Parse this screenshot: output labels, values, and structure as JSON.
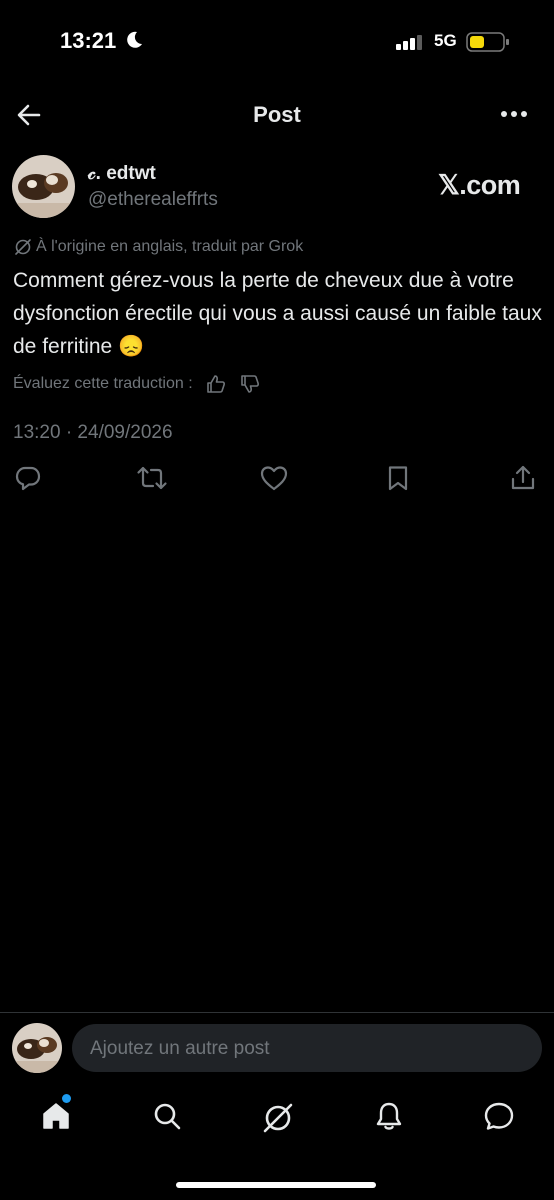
{
  "status_bar": {
    "time": "13:21",
    "network": "5G"
  },
  "header": {
    "title": "Post"
  },
  "post": {
    "author_name": "𝒸. edtwt",
    "author_handle": "@etherealeffrts",
    "source": "𝕏.com",
    "translation_note": "À l'origine en anglais, traduit par Grok",
    "text": "Comment gérez-vous la perte de cheveux due à votre dysfonction érectile qui vous a aussi causé un faible taux de ferritine 😞",
    "rate_label": "Évaluez cette traduction :",
    "timestamp": "13:20 · 24/09/2026"
  },
  "composer": {
    "placeholder": "Ajoutez un autre post"
  },
  "icons": {
    "back": "arrow-left-icon",
    "more": "more-horizontal-icon",
    "reply": "reply-icon",
    "repost": "repost-icon",
    "like": "heart-icon",
    "bookmark": "bookmark-icon",
    "share": "share-icon",
    "home": "home-icon",
    "search": "search-icon",
    "grok": "grok-icon",
    "notifications": "bell-icon",
    "messages": "message-icon"
  },
  "colors": {
    "background": "#000000",
    "text": "#e7e9ea",
    "secondary": "#71767b",
    "accent": "#1d9bf0"
  }
}
